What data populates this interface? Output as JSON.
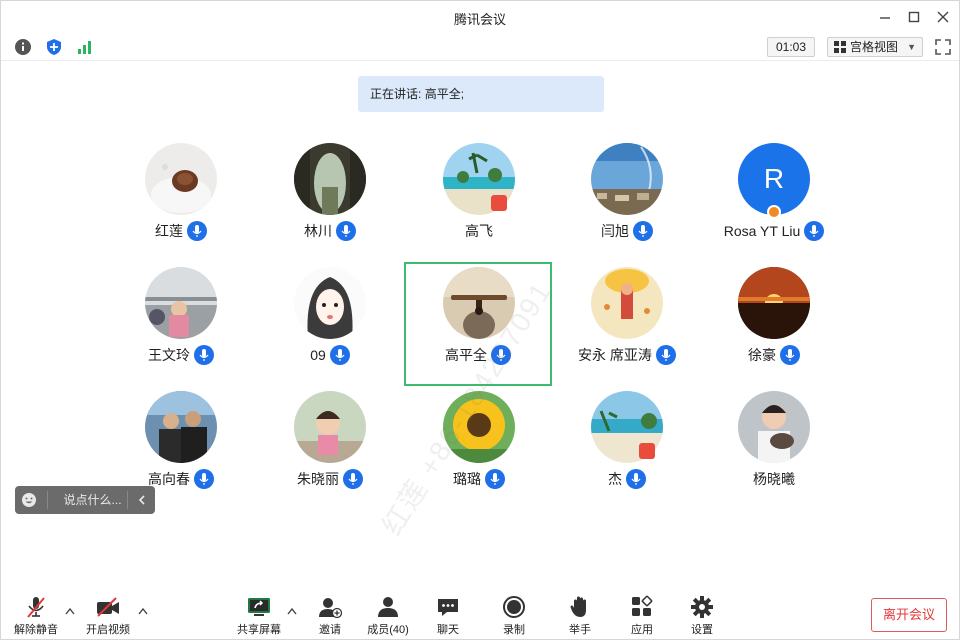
{
  "window": {
    "title": "腾讯会议"
  },
  "toolbar": {
    "timer": "01:03",
    "view_mode": "宫格视图"
  },
  "speaking": {
    "label": "正在讲话:",
    "names": "高平全;"
  },
  "participants": [
    {
      "name": "红莲"
    },
    {
      "name": "林川"
    },
    {
      "name": "高飞"
    },
    {
      "name": "闫旭"
    },
    {
      "name": "Rosa YT Liu",
      "initial": "R"
    },
    {
      "name": "王文玲"
    },
    {
      "name": "09"
    },
    {
      "name": "高平全"
    },
    {
      "name": "安永 席亚涛"
    },
    {
      "name": "徐豪"
    },
    {
      "name": "高向春"
    },
    {
      "name": "朱晓丽"
    },
    {
      "name": "璐璐"
    },
    {
      "name": "杰"
    },
    {
      "name": "杨晓曦"
    }
  ],
  "watermark": "红莲 +86-184267091",
  "chat": {
    "placeholder": "说点什么..."
  },
  "bottom": {
    "unmute": "解除静音",
    "start_video": "开启视频",
    "share_screen": "共享屏幕",
    "invite": "邀请",
    "members": "成员(40)",
    "chat": "聊天",
    "record": "录制",
    "raise_hand": "举手",
    "apps": "应用",
    "settings": "设置",
    "leave": "离开会议"
  },
  "colors": {
    "active_border": "#3ebb6f",
    "mic_blue": "#1f6fe8",
    "leave_red": "#e0393a",
    "banner_bg": "#dbe9fb"
  }
}
